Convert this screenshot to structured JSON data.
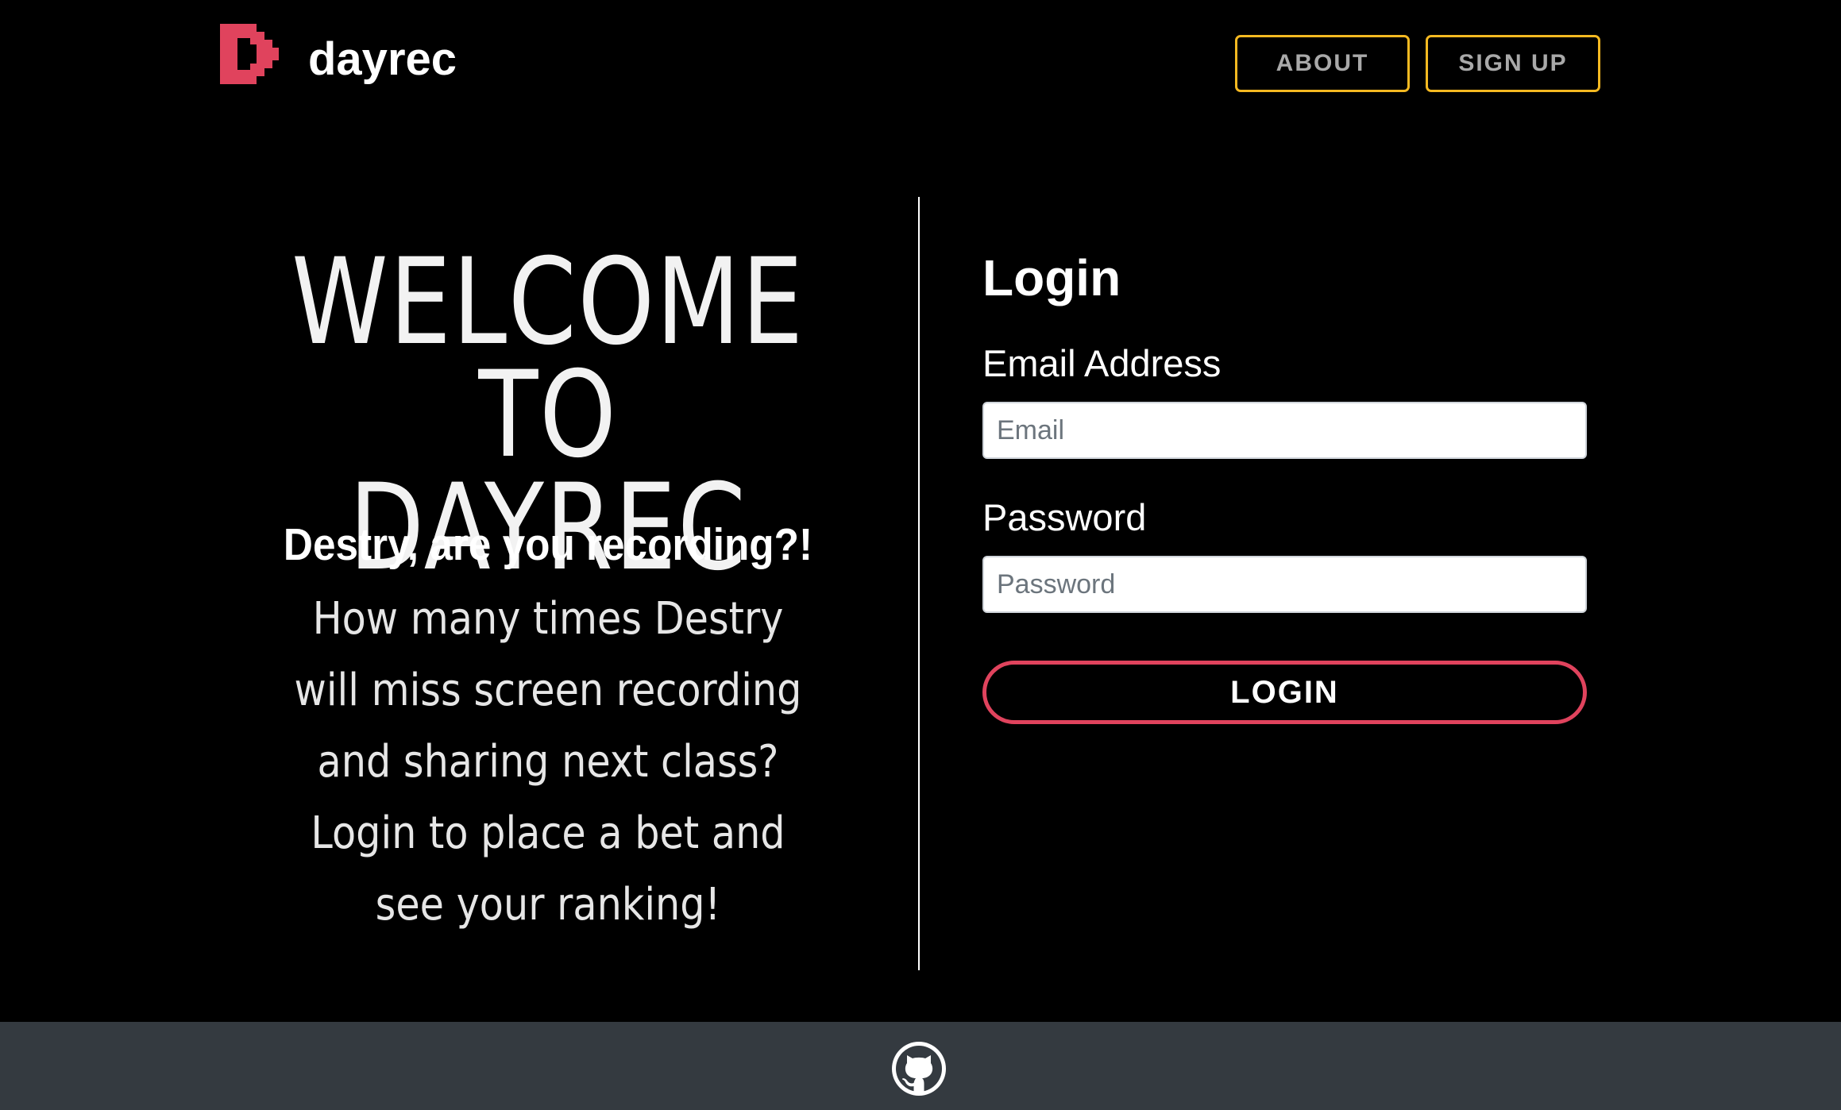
{
  "header": {
    "brand": "dayrec",
    "logo_icon": "dayrec-d-logo-icon",
    "nav": {
      "about_label": "ABOUT",
      "signup_label": "SIGN UP"
    }
  },
  "hero": {
    "title_line1": "WELCOME",
    "title_line2": "TO DAYREC",
    "tagline": "Destry, are you recording?!",
    "description": "How many times Destry will miss screen recording and sharing next class? Login to place a bet and see your ranking!"
  },
  "login_form": {
    "title": "Login",
    "email_label": "Email Address",
    "email_placeholder": "Email",
    "email_value": "",
    "password_label": "Password",
    "password_placeholder": "Password",
    "password_value": "",
    "submit_label": "LOGIN"
  },
  "footer": {
    "github_icon": "github-icon"
  },
  "colors": {
    "background": "#000000",
    "brand_red": "#e0435d",
    "nav_border": "#f5b921",
    "nav_text": "#a9a9a9",
    "footer_bg": "#343a40"
  }
}
